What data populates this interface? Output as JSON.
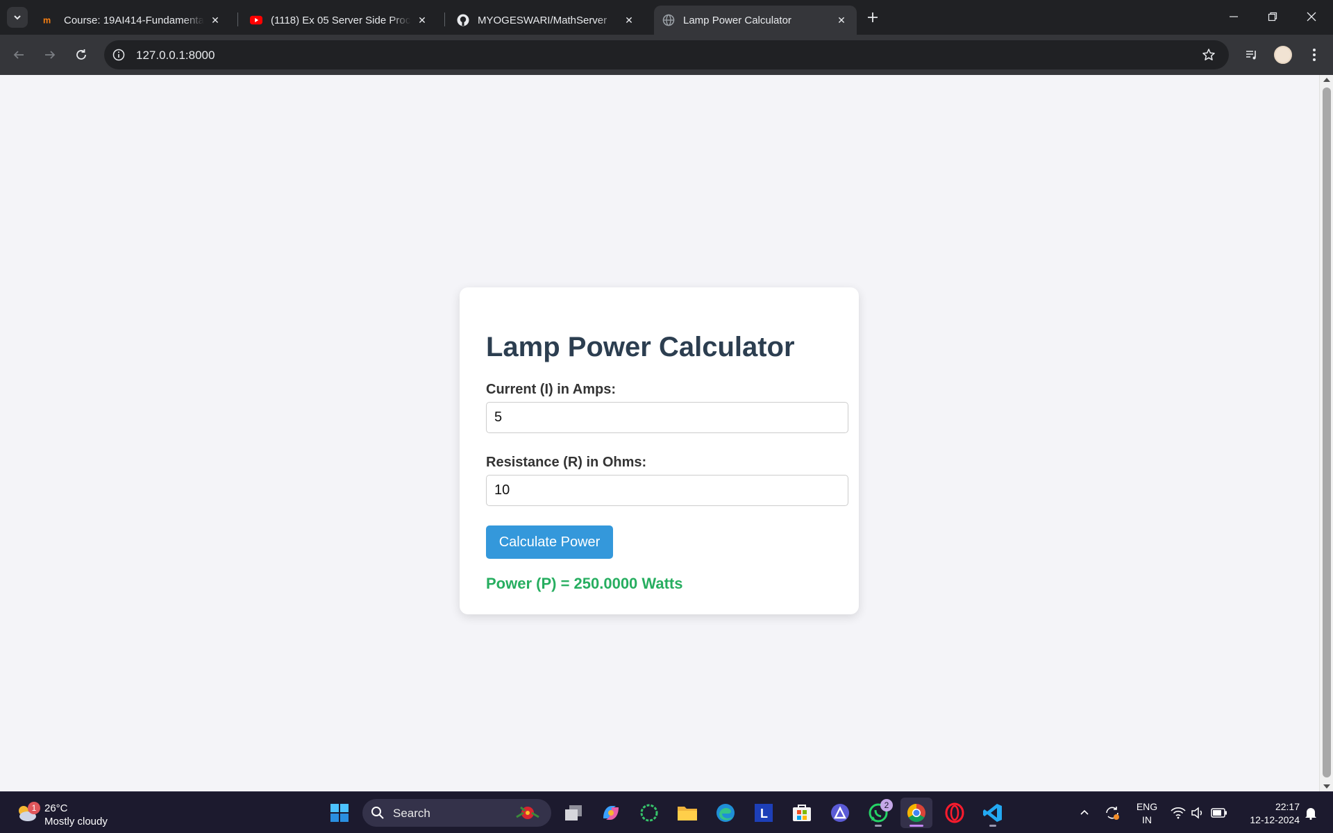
{
  "browser": {
    "tabs": [
      {
        "title": "Course: 19AI414-Fundamentals",
        "icon": "moodle-icon",
        "active": false
      },
      {
        "title": "(1118) Ex 05 Server Side Processing",
        "icon": "youtube-icon",
        "active": false
      },
      {
        "title": "MYOGESWARI/MathServer",
        "icon": "github-icon",
        "active": false
      },
      {
        "title": "Lamp Power Calculator",
        "icon": "globe-icon",
        "active": true
      }
    ],
    "url": "127.0.0.1:8000"
  },
  "page": {
    "heading": "Lamp Power Calculator",
    "current_label": "Current (I) in Amps:",
    "current_value": "5",
    "resistance_label": "Resistance (R) in Ohms:",
    "resistance_value": "10",
    "button_label": "Calculate Power",
    "result": "Power (P) = 250.0000 Watts"
  },
  "colors": {
    "heading": "#2c3e50",
    "button": "#3498db",
    "result": "#27ae60",
    "page_bg": "#f4f4f8"
  },
  "taskbar": {
    "weather_temp": "26°C",
    "weather_condition": "Mostly cloudy",
    "weather_badge": "1",
    "search_label": "Search",
    "whatsapp_badge": "2",
    "language_line1": "ENG",
    "language_line2": "IN",
    "time": "22:17",
    "date": "12-12-2024"
  }
}
